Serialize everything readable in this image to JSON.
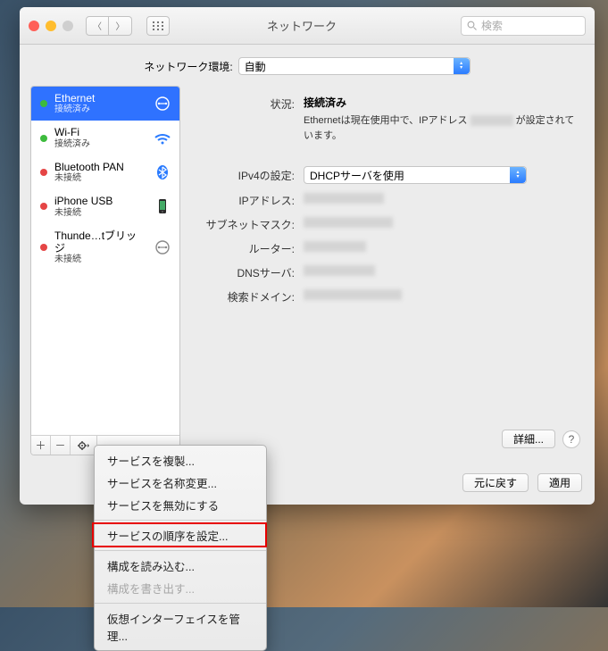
{
  "window": {
    "title": "ネットワーク"
  },
  "search": {
    "placeholder": "検索"
  },
  "location": {
    "label": "ネットワーク環境:",
    "value": "自動"
  },
  "services": [
    {
      "name": "Ethernet",
      "status": "接続済み",
      "dot": "g",
      "icon": "ethernet",
      "selected": true
    },
    {
      "name": "Wi-Fi",
      "status": "接続済み",
      "dot": "g",
      "icon": "wifi",
      "selected": false
    },
    {
      "name": "Bluetooth PAN",
      "status": "未接続",
      "dot": "r",
      "icon": "bluetooth",
      "selected": false
    },
    {
      "name": "iPhone USB",
      "status": "未接続",
      "dot": "r",
      "icon": "iphone",
      "selected": false
    },
    {
      "name": "Thunde…tブリッジ",
      "status": "未接続",
      "dot": "r",
      "icon": "thunderbolt",
      "selected": false
    }
  ],
  "detail": {
    "status_label": "状況:",
    "status_value": "接続済み",
    "status_desc_pre": "Ethernetは現在使用中で、IPアドレス ",
    "status_desc_post": " が設定されています。",
    "ipv4_label": "IPv4の設定:",
    "ipv4_value": "DHCPサーバを使用",
    "ip_label": "IPアドレス:",
    "subnet_label": "サブネットマスク:",
    "router_label": "ルーター:",
    "dns_label": "DNSサーバ:",
    "domain_label": "検索ドメイン:"
  },
  "buttons": {
    "advanced": "詳細...",
    "revert": "元に戻す",
    "apply": "適用"
  },
  "menu": {
    "items": [
      {
        "label": "サービスを複製...",
        "en": true
      },
      {
        "label": "サービスを名称変更...",
        "en": true
      },
      {
        "label": "サービスを無効にする",
        "en": true
      },
      {
        "sep": true
      },
      {
        "label": "サービスの順序を設定...",
        "en": true,
        "hl": true
      },
      {
        "sep": true
      },
      {
        "label": "構成を読み込む...",
        "en": true
      },
      {
        "label": "構成を書き出す...",
        "en": false
      },
      {
        "sep": true
      },
      {
        "label": "仮想インターフェイスを管理...",
        "en": true
      }
    ]
  }
}
